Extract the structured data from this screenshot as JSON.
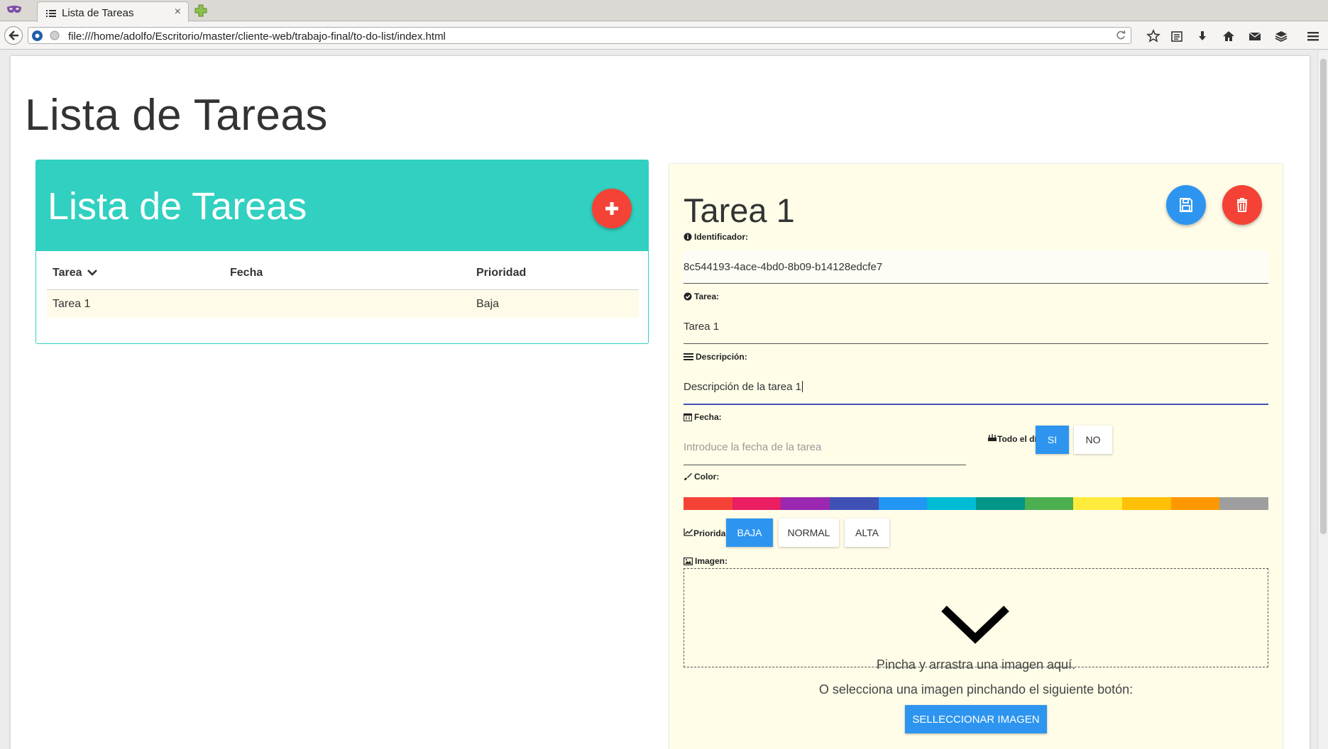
{
  "browser": {
    "tab_title": "Lista de Tareas",
    "tab_close": "×",
    "url": "file:///home/adolfo/Escritorio/master/cliente-web/trabajo-final/to-do-list/index.html",
    "toolbar_icons": [
      "star-icon",
      "reading-list-icon",
      "download-icon",
      "home-icon",
      "mail-icon",
      "pocket-icon",
      "menu-icon"
    ]
  },
  "page": {
    "heading": "Lista de Tareas"
  },
  "list_card": {
    "title": "Lista de Tareas",
    "columns": {
      "tarea": "Tarea",
      "fecha": "Fecha",
      "prioridad": "Prioridad"
    },
    "rows": [
      {
        "tarea": "Tarea 1",
        "fecha": "",
        "prioridad": "Baja"
      }
    ],
    "header_color": "#31d0c0"
  },
  "detail": {
    "title": "Tarea 1",
    "id_label": "Identificador:",
    "id_value": "8c544193-4ace-4bd0-8b09-b14128edcfe7",
    "task_label": "Tarea:",
    "task_value": "Tarea 1",
    "desc_label": "Descripción:",
    "desc_value": "Descripción de la tarea 1",
    "date_label": "Fecha:",
    "date_placeholder": "Introduce la fecha de la tarea",
    "allday_label": "Todo el día:",
    "allday_yes": "SI",
    "allday_no": "NO",
    "allday_selected": "SI",
    "color_label": "Color:",
    "colors": [
      "#f44336",
      "#e91e63",
      "#9c27b0",
      "#3f51b5",
      "#2196f3",
      "#00bcd4",
      "#009688",
      "#4caf50",
      "#ffeb3b",
      "#ffc107",
      "#ff9800",
      "#9e9e9e"
    ],
    "priority_label": "Prioridad:",
    "priority_options": [
      "BAJA",
      "NORMAL",
      "ALTA"
    ],
    "priority_selected": "BAJA",
    "image_label": "Imagen:",
    "drop_text": "Pincha y arrastra una imagen aquí.",
    "select_text": "O selecciona una imagen pinchando el siguiente botón:",
    "select_button": "SELLECCIONAR IMAGEN",
    "accent_blue": "#2d95ef",
    "accent_red": "#f44336"
  }
}
